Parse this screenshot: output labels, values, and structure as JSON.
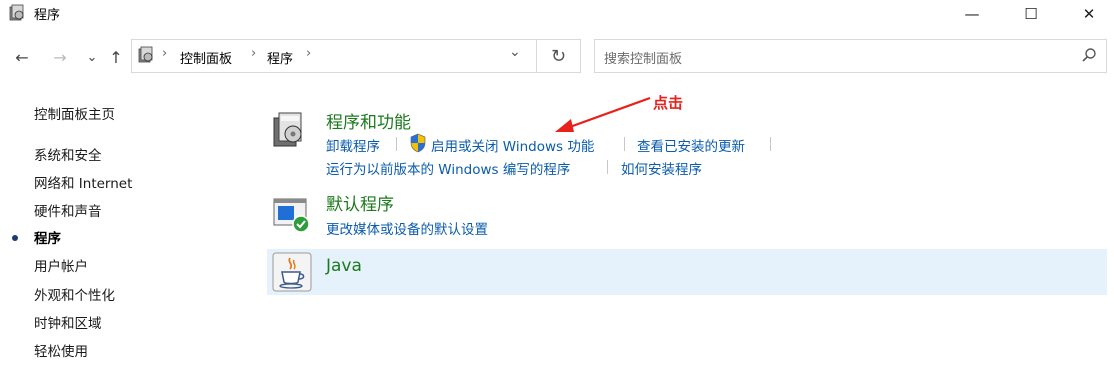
{
  "window": {
    "title": "程序",
    "controls": {
      "minimize": "—",
      "maximize": "☐",
      "close": "✕"
    }
  },
  "nav": {
    "back": "←",
    "forward": "→",
    "recent": "⌄",
    "up": "↑",
    "breadcrumb": [
      "控制面板",
      "程序"
    ],
    "separator": "›",
    "dropdown": "⌄",
    "refresh": "↻"
  },
  "search": {
    "placeholder": "搜索控制面板"
  },
  "sidebar": {
    "items": [
      {
        "label": "控制面板主页",
        "active": false
      },
      {
        "label": "系统和安全",
        "active": false
      },
      {
        "label": "网络和 Internet",
        "active": false
      },
      {
        "label": "硬件和声音",
        "active": false
      },
      {
        "label": "程序",
        "active": true
      },
      {
        "label": "用户帐户",
        "active": false
      },
      {
        "label": "外观和个性化",
        "active": false
      },
      {
        "label": "时钟和区域",
        "active": false
      },
      {
        "label": "轻松使用",
        "active": false
      }
    ]
  },
  "categories": {
    "programs": {
      "title": "程序和功能",
      "icon": "programs-features-icon",
      "links": [
        "卸载程序",
        "启用或关闭 Windows 功能",
        "查看已安装的更新",
        "运行为以前版本的 Windows 编写的程序",
        "如何安装程序"
      ]
    },
    "defaults": {
      "title": "默认程序",
      "icon": "default-programs-icon",
      "links": [
        "更改媒体或设备的默认设置"
      ]
    },
    "java": {
      "title": "Java",
      "icon": "java-cup-icon"
    }
  },
  "annotation": {
    "text": "点击",
    "color": "#e8211b"
  },
  "colors": {
    "link": "#0b5cad",
    "category_title": "#1e7a1e",
    "hover_row": "#e5f1fb"
  }
}
